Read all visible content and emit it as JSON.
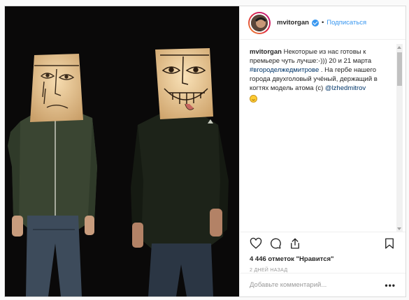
{
  "post": {
    "username": "mvitorgan",
    "follow_label": "Подписаться",
    "separator": "•",
    "caption": {
      "author": "mvitorgan",
      "text_1": " Некоторые из нас готовы к премьере чуть лучше:-))) 20 и 21 марта ",
      "hashtag": "#вгороделжедмитрове",
      "text_2": " . На гербе нашего города двухголовый учёный, держащий в когтях модель атома (с) ",
      "mention": "@lzhedmitrov"
    },
    "likes": "4 446 отметок \"Нравится\"",
    "time": "2 ДНЕЙ НАЗАД",
    "comment_placeholder": "Добавьте комментарий...",
    "more_label": "•••"
  },
  "icons": {
    "like": "heart-icon",
    "comment": "comment-icon",
    "share": "share-icon",
    "save": "bookmark-icon",
    "verified": "verified-badge-icon",
    "emoji": "smiling-emoji-icon"
  },
  "colors": {
    "link": "#3897f0",
    "hashtag": "#003569",
    "border": "#dbdbdb",
    "muted": "#999999"
  }
}
